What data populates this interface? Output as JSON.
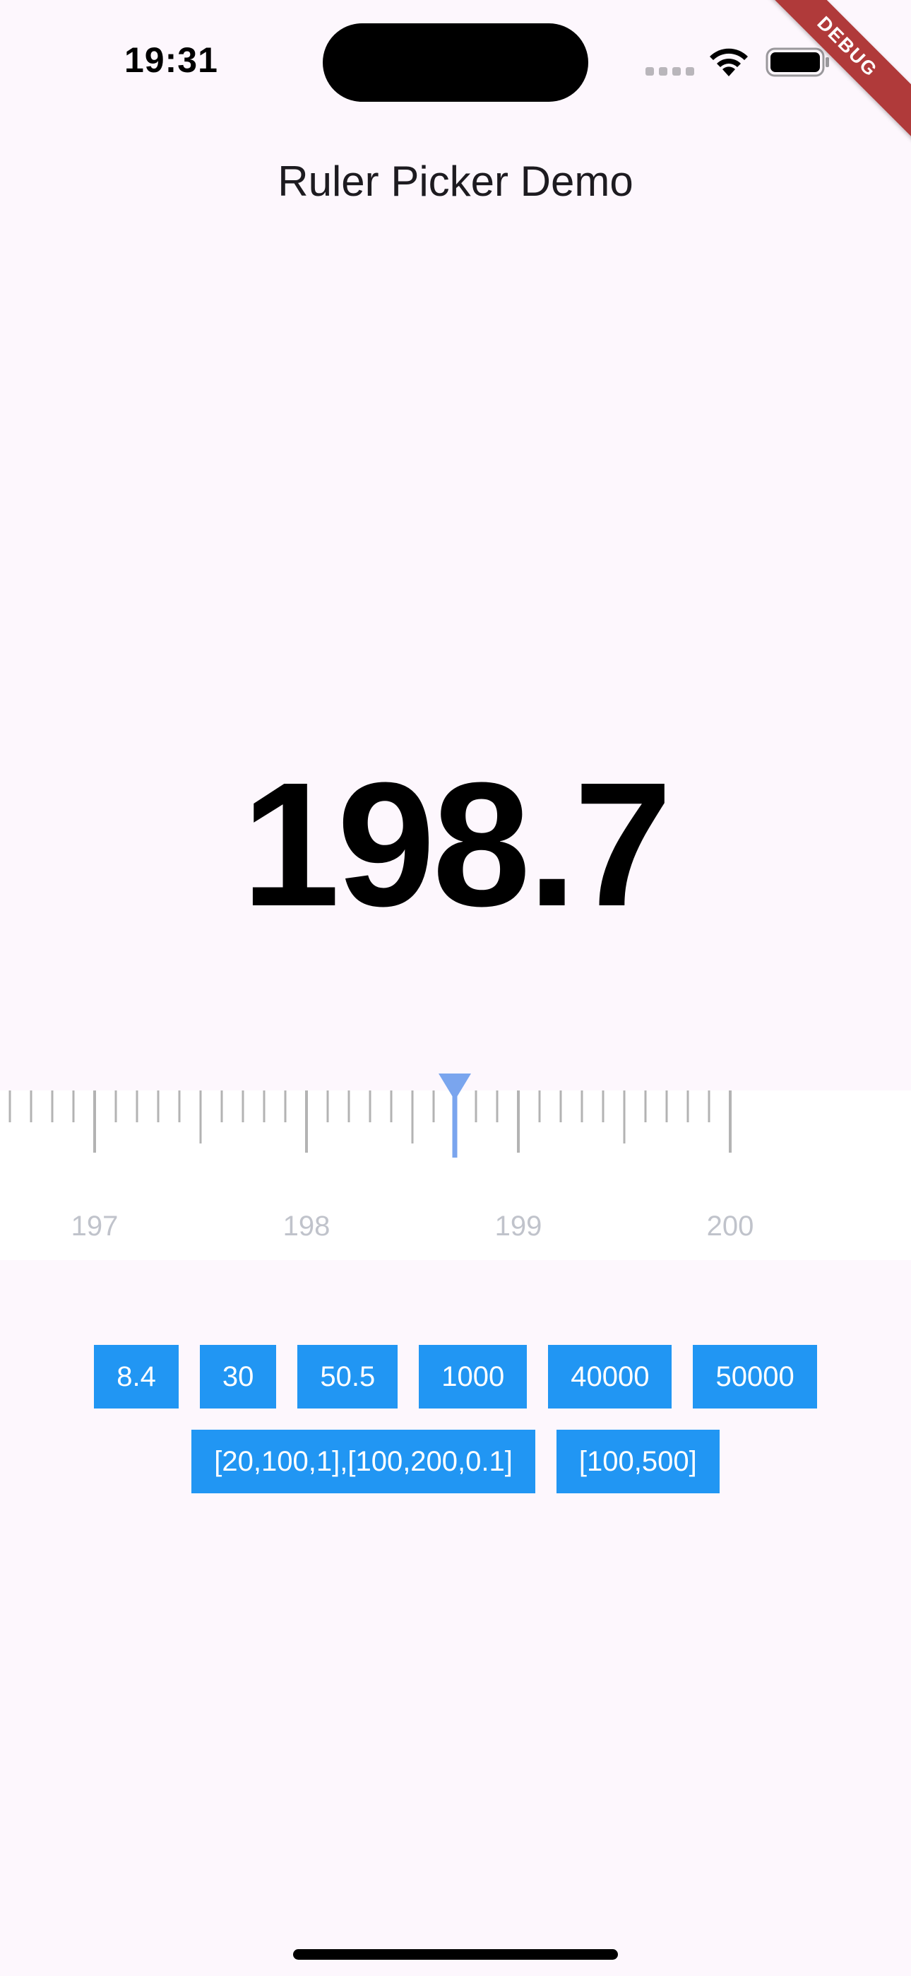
{
  "status_bar": {
    "time": "19:31",
    "icons": [
      "signal-dots-icon",
      "wifi-icon",
      "battery-icon"
    ]
  },
  "debug_banner": "DEBUG",
  "app_bar": {
    "title": "Ruler Picker Demo"
  },
  "current_value": "198.7",
  "ruler": {
    "tick_labels": [
      "197",
      "198",
      "199",
      "200"
    ],
    "min_value": 196.6,
    "max_value": 200.0,
    "step": 0.1,
    "selected_value": 198.7,
    "tick_color": "#b3b3b3",
    "label_color": "#c0c3cb",
    "indicator_color": "#7aa5ee"
  },
  "preset_buttons_row1": [
    "8.4",
    "30",
    "50.5",
    "1000",
    "40000",
    "50000"
  ],
  "preset_buttons_row2": [
    "[20,100,1],[100,200,0.1]",
    "[100,500]"
  ],
  "colors": {
    "background": "#fdf7fd",
    "button": "#2196f3",
    "button_text": "#ffffff",
    "ruler_background": "#ffffff"
  }
}
